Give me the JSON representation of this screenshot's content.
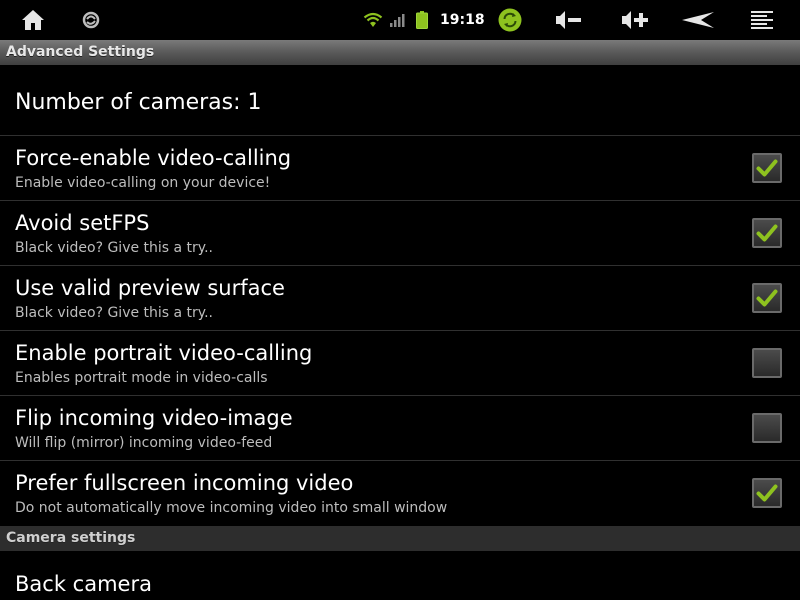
{
  "status_bar": {
    "time": "19:18",
    "icons": [
      "home-icon",
      "app-notification-icon",
      "wifi-icon",
      "signal-icon",
      "battery-icon",
      "sync-icon",
      "volume-down-icon",
      "volume-up-icon",
      "back-icon",
      "menu-icon"
    ],
    "accent_green": "#8ec21f"
  },
  "header": {
    "title": "Advanced Settings"
  },
  "cameras": {
    "label": "Number of cameras: 1"
  },
  "preferences": [
    {
      "title": "Force-enable video-calling",
      "summary": "Enable video-calling on your device!",
      "checked": true
    },
    {
      "title": "Avoid setFPS",
      "summary": "Black video? Give this a try..",
      "checked": true
    },
    {
      "title": "Use valid preview surface",
      "summary": "Black video? Give this a try..",
      "checked": true
    },
    {
      "title": "Enable portrait video-calling",
      "summary": "Enables portrait mode in video-calls",
      "checked": false
    },
    {
      "title": "Flip incoming video-image",
      "summary": "Will flip (mirror) incoming video-feed",
      "checked": false
    },
    {
      "title": "Prefer fullscreen incoming video",
      "summary": "Do not automatically move incoming video into small window",
      "checked": true
    }
  ],
  "camera_settings": {
    "header": "Camera settings",
    "items": [
      {
        "title": "Back camera"
      }
    ]
  }
}
